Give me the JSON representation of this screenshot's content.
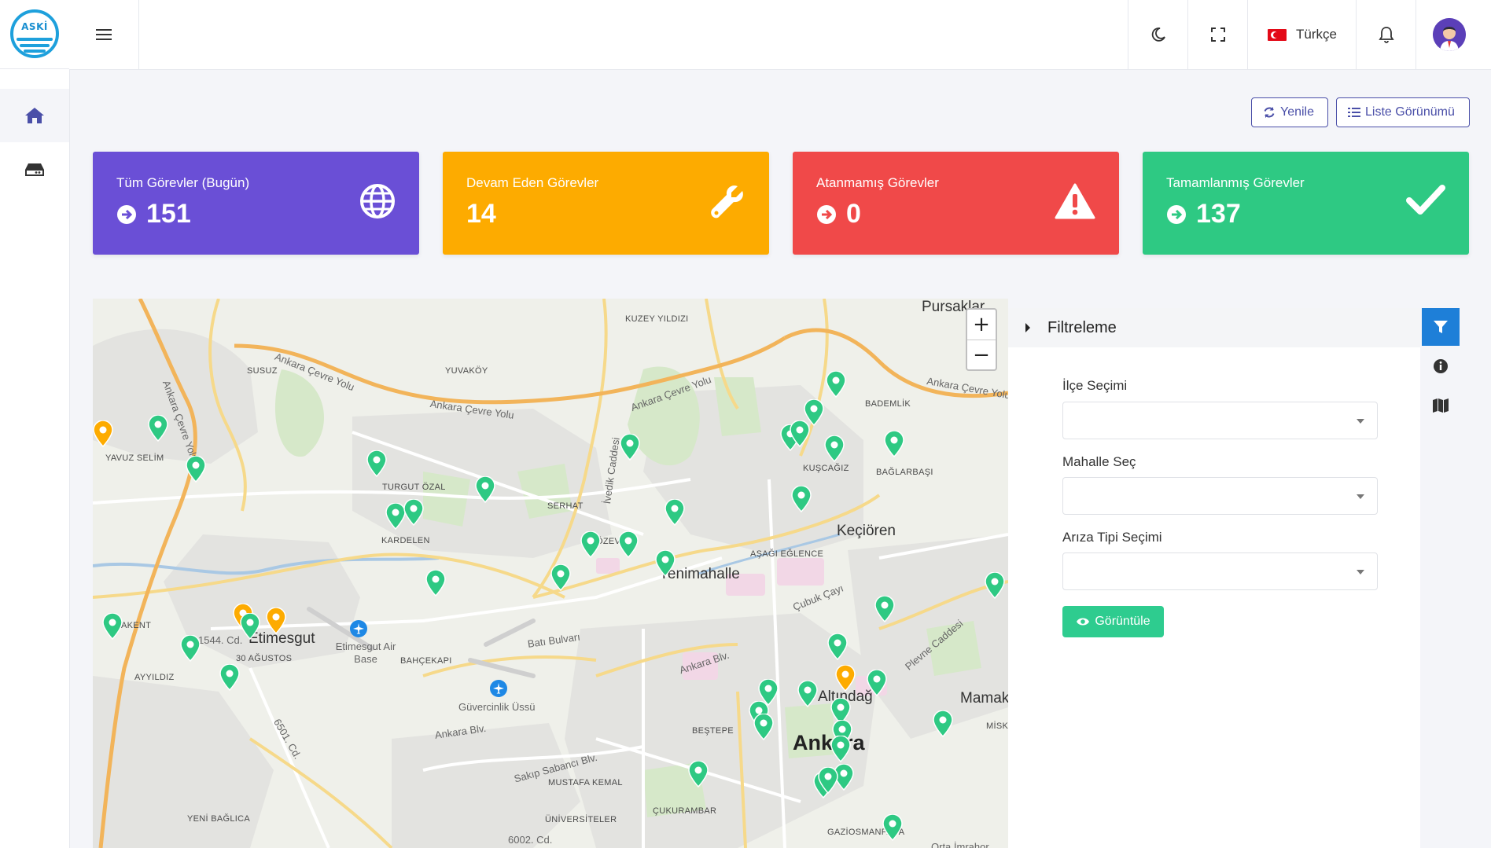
{
  "logo": {
    "text": "ASKİ"
  },
  "header": {
    "language": "Türkçe"
  },
  "toolbar": {
    "refresh_label": "Yenile",
    "list_view_label": "Liste Görünümü"
  },
  "cards": [
    {
      "title": "Tüm Görevler (Bugün)",
      "value": "151",
      "color": "#6a4fd6",
      "icon": "globe-icon"
    },
    {
      "title": "Devam Eden Görevler",
      "value": "14",
      "color": "#fdab00",
      "icon": "wrench-icon"
    },
    {
      "title": "Atanmamış Görevler",
      "value": "0",
      "color": "#f04949",
      "icon": "warning-icon"
    },
    {
      "title": "Tamamlanmış Görevler",
      "value": "137",
      "color": "#2ec983",
      "icon": "check-icon"
    }
  ],
  "map": {
    "zoom_in": "+",
    "zoom_out": "−",
    "labels": {
      "pursaklar": "Pursaklar",
      "kuzey_yildizi": "KUZEY YILDIZI",
      "yuvakoy": "YUVAKÖY",
      "susuz": "SUSUZ",
      "ankara_cevre_yolu": "Ankara Çevre Yolu",
      "yavuz_selim": "YAVUZ SELİM",
      "turgut_ozal": "TURGUT ÖZAL",
      "serhat": "SERHAT",
      "ivedik": "İvedik Caddesi",
      "kardelen": "KARDELEN",
      "ozevler": "ÖZEV",
      "bademlik": "BADEMLİK",
      "kuscagiz": "KUŞCAĞIZ",
      "baglarbasi": "BAĞLARBAŞI",
      "kecioren": "Keçiören",
      "asagi_eglence": "AŞAĞI EĞLENCE",
      "yenimahalle": "Yenimahalle",
      "cubuk_cayi": "Çubuk Çayı",
      "etimesgut": "Etimesgut",
      "cd_1544": "1544. Cd.",
      "otuz_agustos": "30 AĞUSTOS",
      "etimesgut_air_base": "Etimesgut Air Base",
      "bahcekapi": "BAHÇEKAPI",
      "bati_bulvari": "Batı Bulvarı",
      "ankara_blv": "Ankara Blv.",
      "plevne": "Plevne Caddesi",
      "akent": "AKENT",
      "ayyildiz": "AYYILDIZ",
      "guvercinlik": "Güvercinlik Üssü",
      "altindag": "Altındağ",
      "mamak": "Mamak",
      "besteppe": "BEŞTEPE",
      "misk": "MİSK",
      "ankara": "Ankara",
      "cd_6501": "6501. Cd.",
      "sakip_sabanci": "Sakıp Sabancı Blv.",
      "mustafa_kemal": "MUSTAFA KEMAL",
      "cukurambar": "ÇUKURAMBAR",
      "yeni_baglica": "YENİ BAĞLICA",
      "universiteler": "ÜNİVERSİTELER",
      "cd_6002": "6002. Cd.",
      "gaziosmanpasa": "GAZİOSMANPAŞA",
      "orta_imrahor": "Orta İmrahor"
    }
  },
  "filter": {
    "title": "Filtreleme",
    "district_label": "İlçe Seçimi",
    "neighborhood_label": "Mahalle Seç",
    "fault_type_label": "Arıza Tipi Seçimi",
    "show_button": "Görüntüle"
  },
  "colors": {
    "accent": "#4a4fa8",
    "pin_green": "#2ec983",
    "pin_orange": "#fdab00",
    "filter_tab": "#1e7fd8"
  }
}
